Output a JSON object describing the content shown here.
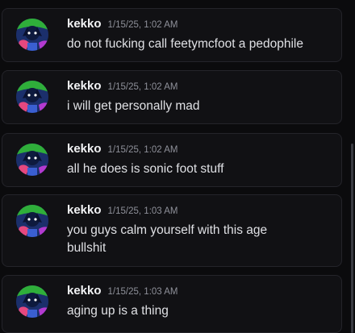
{
  "messages": [
    {
      "author": "kekko",
      "timestamp": "1/15/25, 1:02 AM",
      "text": "do not fucking call feetymcfoot a pedophile"
    },
    {
      "author": "kekko",
      "timestamp": "1/15/25, 1:02 AM",
      "text": "i will get personally mad"
    },
    {
      "author": "kekko",
      "timestamp": "1/15/25, 1:02 AM",
      "text": "all he does is sonic foot stuff"
    },
    {
      "author": "kekko",
      "timestamp": "1/15/25, 1:03 AM",
      "text": "you guys calm yourself with this age bullshit"
    },
    {
      "author": "kekko",
      "timestamp": "1/15/25, 1:03 AM",
      "text": "aging up is a thing"
    }
  ]
}
